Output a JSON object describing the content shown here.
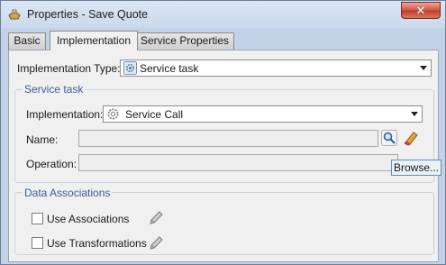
{
  "window": {
    "title": "Properties - Save Quote",
    "close_glyph": "✕"
  },
  "tabs": [
    {
      "label": "Basic",
      "active": false
    },
    {
      "label": "Implementation",
      "active": true
    },
    {
      "label": "Service Properties",
      "active": false
    }
  ],
  "implementation_type": {
    "label": "Implementation Type:",
    "value": "Service task",
    "icon": "gear-icon"
  },
  "service_task": {
    "group_title": "Service task",
    "implementation_label": "Implementation:",
    "implementation_value": "Service Call",
    "implementation_icon": "gear-icon",
    "name_label": "Name:",
    "name_value": "",
    "operation_label": "Operation:",
    "operation_value": "",
    "browse_label": "Browse..."
  },
  "data_associations": {
    "group_title": "Data Associations",
    "use_associations_label": "Use Associations",
    "use_associations_checked": false,
    "use_transformations_label": "Use Transformations",
    "use_transformations_checked": false
  },
  "colors": {
    "group_title": "#3a5d9c",
    "close_button": "#c0382a"
  }
}
